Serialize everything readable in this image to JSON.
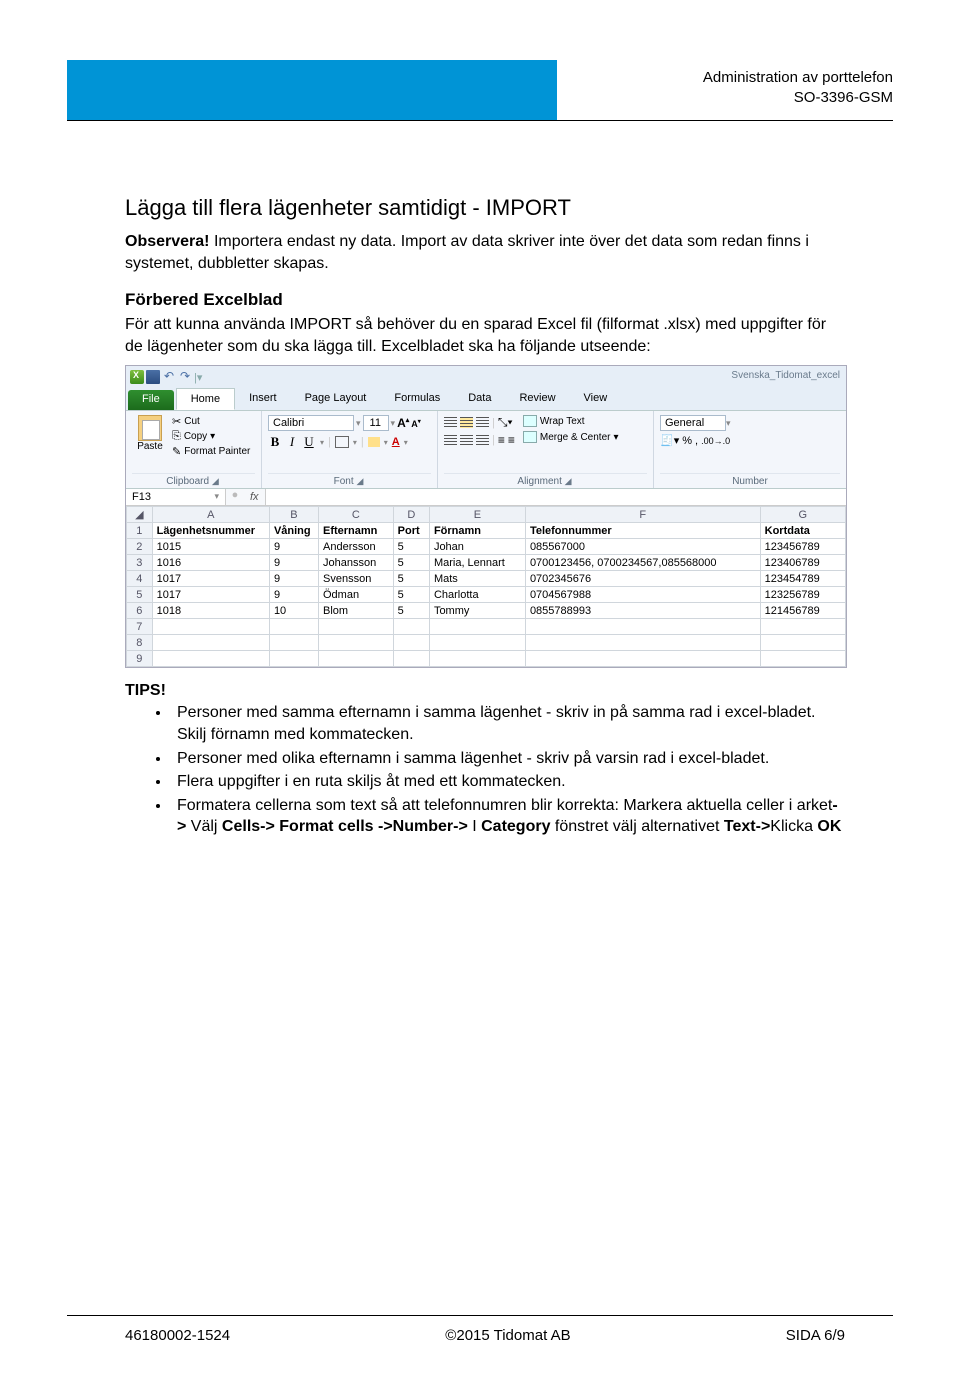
{
  "header": {
    "line1": "Administration av porttelefon",
    "line2": "SO-3396-GSM"
  },
  "title": "Lägga till flera lägenheter samtidigt - IMPORT",
  "intro": {
    "observera": "Observera!",
    "text": " Importera endast ny data. Import av data skriver inte över det data som redan finns i systemet, dubbletter skapas."
  },
  "section2": {
    "heading": "Förbered Excelblad",
    "text": "För att kunna använda IMPORT så behöver du en sparad Excel fil (filformat .xlsx) med uppgifter för de lägenheter som du ska lägga till. Excelbladet ska ha följande utseende:"
  },
  "excel": {
    "workbook_name": "Svenska_Tidomat_excel",
    "tabs": {
      "file": "File",
      "home": "Home",
      "insert": "Insert",
      "page_layout": "Page Layout",
      "formulas": "Formulas",
      "data": "Data",
      "review": "Review",
      "view": "View"
    },
    "clipboard": {
      "paste": "Paste",
      "cut": "Cut",
      "copy": "Copy",
      "format_painter": "Format Painter",
      "group": "Clipboard"
    },
    "font": {
      "name": "Calibri",
      "size": "11",
      "group": "Font"
    },
    "alignment": {
      "wrap": "Wrap Text",
      "merge": "Merge & Center",
      "group": "Alignment"
    },
    "number": {
      "format": "General",
      "group": "Number"
    },
    "namebox": "F13",
    "fx": "fx",
    "columns": [
      "A",
      "B",
      "C",
      "D",
      "E",
      "F",
      "G"
    ],
    "headers": [
      "Lägenhetsnummer",
      "Våning",
      "Efternamn",
      "Port",
      "Förnamn",
      "Telefonnummer",
      "Kortdata"
    ],
    "rows": [
      [
        "1015",
        "9",
        "Andersson",
        "5",
        "Johan",
        "085567000",
        "123456789"
      ],
      [
        "1016",
        "9",
        "Johansson",
        "5",
        "Maria, Lennart",
        "0700123456, 0700234567,085568000",
        "123406789"
      ],
      [
        "1017",
        "9",
        "Svensson",
        "5",
        "Mats",
        "0702345676",
        "123454789"
      ],
      [
        "1017",
        "9",
        "Ödman",
        "5",
        "Charlotta",
        "0704567988",
        "123256789"
      ],
      [
        "1018",
        "10",
        "Blom",
        "5",
        "Tommy",
        "0855788993",
        "121456789"
      ]
    ]
  },
  "tips": {
    "heading": "TIPS!",
    "items": [
      "Personer med samma efternamn i samma lägenhet - skriv in på samma rad i excel-bladet. Skilj förnamn med kommatecken.",
      "Personer med olika efternamn i samma lägenhet - skriv på varsin rad i excel-bladet.",
      "Flera uppgifter i en ruta skiljs åt med ett kommatecken."
    ],
    "item4_parts": {
      "p1": "Formatera cellerna som text så att telefonnumren blir korrekta: Markera aktuella celler i arket",
      "arrow1": "->",
      "p2": " Välj ",
      "cells": "Cells-> Format cells ->Number-> ",
      "p3": "I ",
      "category": "Category",
      "p4": " fönstret välj alternativet ",
      "text_opt": "Text->",
      "p5": "Klicka ",
      "ok": "OK"
    }
  },
  "footer": {
    "left": "46180002-1524",
    "center": "©2015 Tidomat AB",
    "right": "SIDA 6/9"
  }
}
